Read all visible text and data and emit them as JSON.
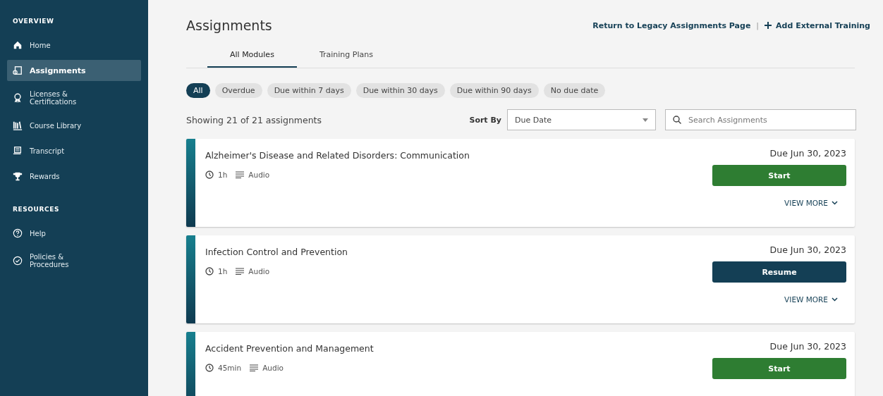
{
  "sidebar": {
    "sections": [
      {
        "heading": "OVERVIEW",
        "items": [
          {
            "label": "Home",
            "selected": false
          },
          {
            "label": "Assignments",
            "selected": true
          },
          {
            "label": "Licenses &\nCertifications",
            "selected": false
          },
          {
            "label": "Course Library",
            "selected": false
          },
          {
            "label": "Transcript",
            "selected": false
          },
          {
            "label": "Rewards",
            "selected": false
          }
        ]
      },
      {
        "heading": "RESOURCES",
        "items": [
          {
            "label": "Help",
            "selected": false
          },
          {
            "label": "Policies &\nProcedures",
            "selected": false
          }
        ]
      }
    ]
  },
  "page": {
    "title": "Assignments",
    "separator": "|",
    "links": [
      {
        "label": "Return to Legacy Assignments Page",
        "kind": "plain"
      },
      {
        "label": "Add External Training",
        "kind": "add"
      }
    ]
  },
  "tabs": [
    {
      "label": "All Modules",
      "selected": true
    },
    {
      "label": "Training Plans",
      "selected": false
    }
  ],
  "filters": [
    {
      "label": "All",
      "selected": true
    },
    {
      "label": "Overdue",
      "selected": false
    },
    {
      "label": "Due within 7 days",
      "selected": false
    },
    {
      "label": "Due within 30 days",
      "selected": false
    },
    {
      "label": "Due within 90 days",
      "selected": false
    },
    {
      "label": "No due date",
      "selected": false
    }
  ],
  "toolbar": {
    "count": "Showing 21 of 21 assignments",
    "sort_label": "Sort By",
    "sort_value": "Due Date",
    "search_placeholder": "Search Assignments"
  },
  "assignments": [
    {
      "title": "Alzheimer's Disease and Related Disorders: Communication",
      "duration": "1h",
      "format": "Audio",
      "due": "Due Jun 30, 2023",
      "action": {
        "label": "Start",
        "kind": "start"
      },
      "more": "VIEW MORE"
    },
    {
      "title": "Infection Control and Prevention",
      "duration": "1h",
      "format": "Audio",
      "due": "Due Jun 30, 2023",
      "action": {
        "label": "Resume",
        "kind": "resume"
      },
      "more": "VIEW MORE"
    },
    {
      "title": "Accident Prevention and Management",
      "duration": "45min",
      "format": "Audio",
      "due": "Due Jun 30, 2023",
      "action": {
        "label": "Start",
        "kind": "start"
      }
    }
  ]
}
